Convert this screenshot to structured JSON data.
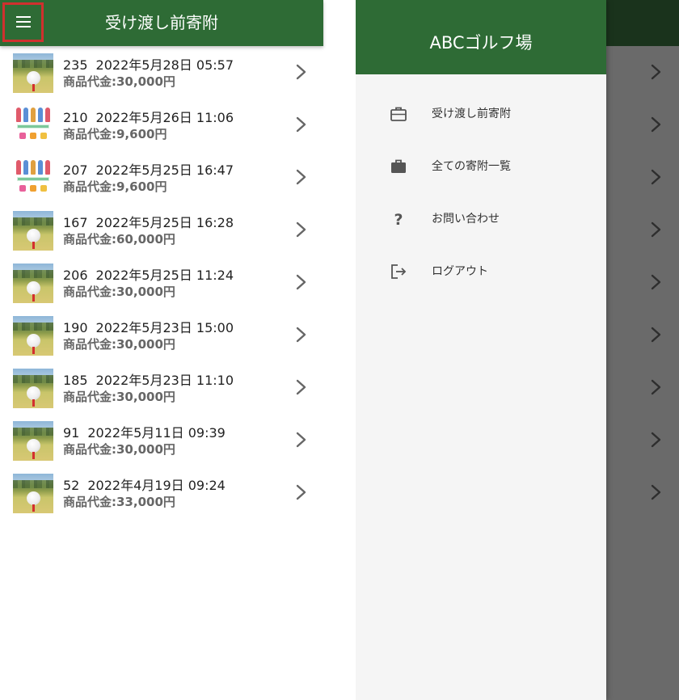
{
  "left_panel": {
    "title": "受け渡し前寄附",
    "menu_icon": "hamburger-menu-icon",
    "accent_color": "#2e6b35",
    "highlight_color": "#d0302e",
    "items": [
      {
        "id": "235",
        "datetime": "2022年5月28日 05:57",
        "price": "商品代金:30,000円",
        "thumb": "golf-ball-image"
      },
      {
        "id": "210",
        "datetime": "2022年5月26日 11:06",
        "price": "商品代金:9,600円",
        "thumb": "golf-set-image"
      },
      {
        "id": "207",
        "datetime": "2022年5月25日 16:47",
        "price": "商品代金:9,600円",
        "thumb": "golf-set-image"
      },
      {
        "id": "167",
        "datetime": "2022年5月25日 16:28",
        "price": "商品代金:60,000円",
        "thumb": "golf-ball-image"
      },
      {
        "id": "206",
        "datetime": "2022年5月25日 11:24",
        "price": "商品代金:30,000円",
        "thumb": "golf-ball-image"
      },
      {
        "id": "190",
        "datetime": "2022年5月23日 15:00",
        "price": "商品代金:30,000円",
        "thumb": "golf-ball-image"
      },
      {
        "id": "185",
        "datetime": "2022年5月23日 11:10",
        "price": "商品代金:30,000円",
        "thumb": "golf-ball-image"
      },
      {
        "id": "91",
        "datetime": "2022年5月11日 09:39",
        "price": "商品代金:30,000円",
        "thumb": "golf-ball-image"
      },
      {
        "id": "52",
        "datetime": "2022年4月19日 09:24",
        "price": "商品代金:33,000円",
        "thumb": "golf-ball-image"
      }
    ]
  },
  "drawer": {
    "title": "ABCゴルフ場",
    "menu": [
      {
        "label": "受け渡し前寄附",
        "icon": "briefcase-outline-icon"
      },
      {
        "label": "全ての寄附一覧",
        "icon": "briefcase-filled-icon"
      },
      {
        "label": "お問い合わせ",
        "icon": "question-mark-icon"
      },
      {
        "label": "ログアウト",
        "icon": "logout-icon"
      }
    ]
  }
}
